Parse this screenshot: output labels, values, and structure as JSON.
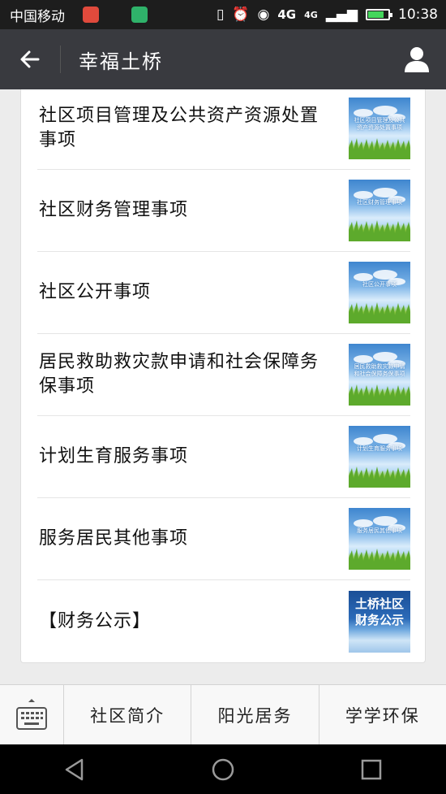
{
  "status_bar": {
    "carrier": "中国移动",
    "network": "4G",
    "network_small": "4G",
    "time": "10:38",
    "battery_level": 0.8,
    "icons": [
      "red-app-icon",
      "green-app-icon",
      "vibrate-icon",
      "alarm-icon",
      "eye-icon",
      "signal-icon",
      "battery-icon"
    ]
  },
  "titlebar": {
    "title": "幸福土桥",
    "back_icon": "arrow-left-icon",
    "profile_icon": "user-icon"
  },
  "articles": [
    {
      "title": "社区项目管理及公共资产资源处置事项",
      "thumb_caption": "社区项目管理及公共资产资源处置事项",
      "thumb_style": "light"
    },
    {
      "title": "社区财务管理事项",
      "thumb_caption": "社区财务管理事项",
      "thumb_style": "light"
    },
    {
      "title": "社区公开事项",
      "thumb_caption": "社区公开事项",
      "thumb_style": "light"
    },
    {
      "title": "居民救助救灾款申请和社会保障务保事项",
      "thumb_caption": "居民救助救灾款申请和社会保障务保事项",
      "thumb_style": "light"
    },
    {
      "title": "计划生育服务事项",
      "thumb_caption": "计划生育服务事项",
      "thumb_style": "light"
    },
    {
      "title": "服务居民其他事项",
      "thumb_caption": "服务居民其他事项",
      "thumb_style": "light"
    },
    {
      "title": "【财务公示】",
      "thumb_caption": "土桥社区财务公示",
      "thumb_style": "dark"
    }
  ],
  "bottom_menu": {
    "keyboard_icon": "keyboard-icon",
    "items": [
      "社区简介",
      "阳光居务",
      "学学环保"
    ]
  },
  "navbar": {
    "icons": [
      "back-triangle-icon",
      "home-circle-icon",
      "recent-square-icon"
    ]
  },
  "colors": {
    "titlebar_bg": "#393a3f",
    "statusbar_bg": "#1d1d1d",
    "page_bg": "#ececec"
  }
}
